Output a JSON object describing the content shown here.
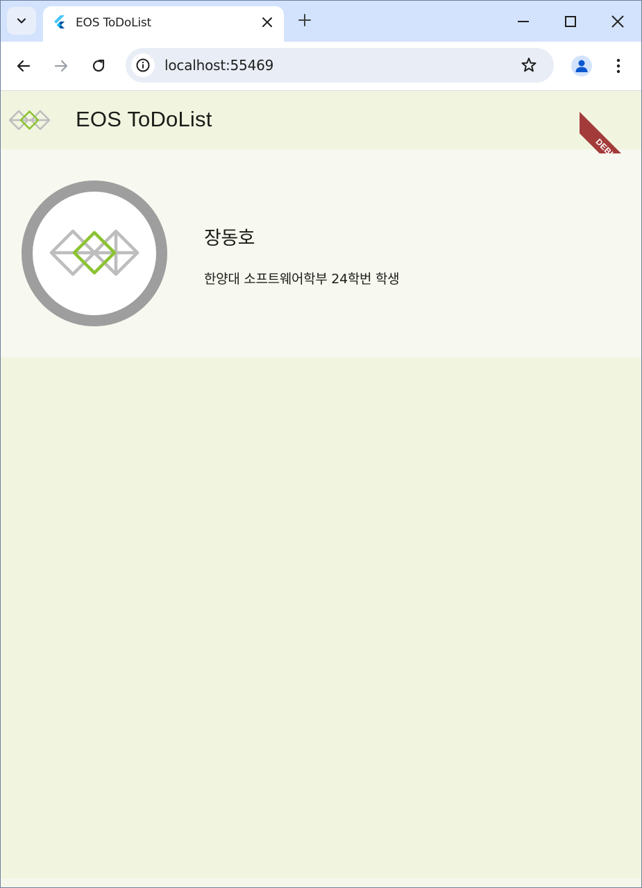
{
  "browser": {
    "tab_title": "EOS ToDoList",
    "url": "localhost:55469"
  },
  "app": {
    "title": "EOS ToDoList",
    "debug_label": "DEBUG",
    "colors": {
      "background": "#f1f5e0",
      "card": "#f7f8ef",
      "logo_green": "#8bc332",
      "logo_gray": "#bdbdbd",
      "avatar_ring": "#9e9e9e"
    }
  },
  "profile": {
    "name": "장동호",
    "description": "한양대 소프트웨어학부 24학번 학생"
  }
}
